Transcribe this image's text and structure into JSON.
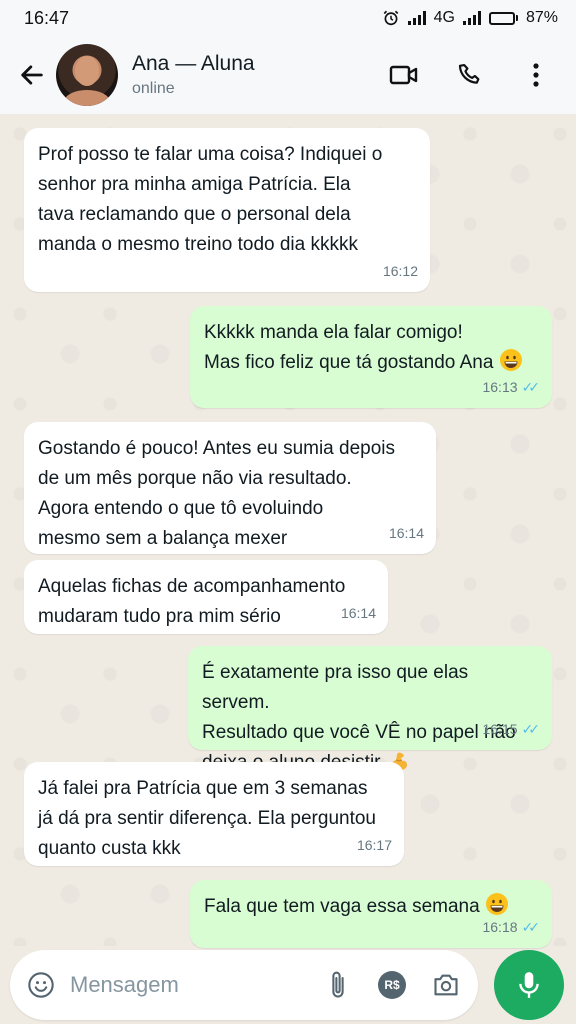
{
  "status_bar": {
    "time": "16:47",
    "network": "4G",
    "battery": "87%",
    "battery_level": 0.87
  },
  "header": {
    "contact_name": "Ana — Aluna",
    "contact_status": "online",
    "icons": [
      "back-arrow-icon",
      "video-call-icon",
      "phone-icon",
      "more-vert-icon"
    ]
  },
  "messages": [
    {
      "direction": "in",
      "lines": [
        "Prof posso te falar uma coisa? Indiquei o",
        "senhor pra minha amiga Patrícia. Ela",
        "tava reclamando que o personal dela",
        "manda o mesmo treino todo dia kkkkk"
      ],
      "time": "16:12"
    },
    {
      "direction": "out",
      "lines": [
        "Kkkkk manda ela falar comigo!",
        "Mas fico feliz que tá gostando Ana"
      ],
      "emoji": "grinning-face",
      "time": "16:13",
      "read": true
    },
    {
      "direction": "in",
      "lines": [
        "Gostando é pouco! Antes eu sumia depois",
        "de um mês porque não via resultado.",
        "Agora entendo o que tô evoluindo",
        "mesmo sem a balança mexer"
      ],
      "time": "16:14"
    },
    {
      "direction": "in",
      "lines": [
        "Aquelas fichas de acompanhamento",
        "mudaram tudo pra mim sério"
      ],
      "time": "16:14"
    },
    {
      "direction": "out",
      "lines": [
        "É exatamente pra isso que elas servem.",
        "Resultado que você VÊ no papel não",
        "deixa o aluno desistir"
      ],
      "emoji": "flexed-biceps",
      "time": "16:15",
      "read": true
    },
    {
      "direction": "in",
      "lines": [
        "Já falei pra Patrícia que em 3 semanas",
        "já dá pra sentir diferença. Ela perguntou",
        "quanto custa kkk"
      ],
      "time": "16:17"
    },
    {
      "direction": "out",
      "lines": [
        "Fala que tem vaga essa semana"
      ],
      "emoji": "grinning-face",
      "time": "16:18",
      "read": true
    }
  ],
  "input": {
    "placeholder": "Mensagem",
    "currency_label": "R$",
    "icons": [
      "emoji-icon",
      "attach-icon",
      "payment-icon",
      "camera-icon",
      "mic-icon"
    ]
  },
  "colors": {
    "chat_background": "#efeae2",
    "incoming_bubble": "#ffffff",
    "outgoing_bubble": "#d9fdd3",
    "read_ticks": "#53bdeb",
    "mic_button": "#1daa61"
  }
}
